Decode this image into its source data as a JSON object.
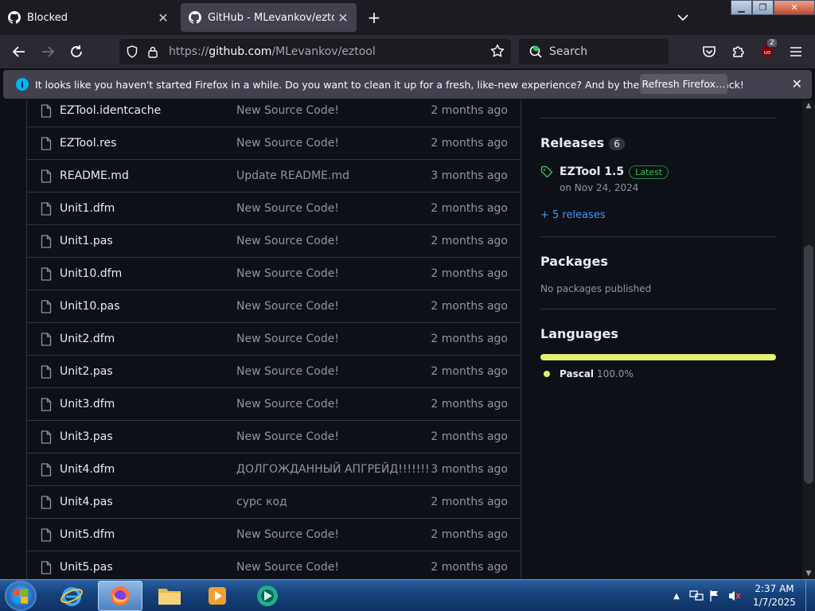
{
  "tabs": [
    {
      "title": "Blocked",
      "active": false
    },
    {
      "title": "GitHub - MLevankov/eztool: Пр",
      "active": true
    }
  ],
  "url": {
    "prefix": "https://",
    "host": "github.com",
    "path": "/MLevankov/eztool"
  },
  "search": {
    "placeholder": "Search"
  },
  "extension_badge": "2",
  "notification": {
    "message": "It looks like you haven't started Firefox in a while. Do you want to clean it up for a fresh, like-new experience? And by the way, welcome back!",
    "button": "Refresh Firefox…"
  },
  "files": [
    {
      "name": "EZTool.identcache",
      "commit": "New Source Code!",
      "age": "2 months ago"
    },
    {
      "name": "EZTool.res",
      "commit": "New Source Code!",
      "age": "2 months ago"
    },
    {
      "name": "README.md",
      "commit": "Update README.md",
      "age": "3 months ago"
    },
    {
      "name": "Unit1.dfm",
      "commit": "New Source Code!",
      "age": "2 months ago"
    },
    {
      "name": "Unit1.pas",
      "commit": "New Source Code!",
      "age": "2 months ago"
    },
    {
      "name": "Unit10.dfm",
      "commit": "New Source Code!",
      "age": "2 months ago"
    },
    {
      "name": "Unit10.pas",
      "commit": "New Source Code!",
      "age": "2 months ago"
    },
    {
      "name": "Unit2.dfm",
      "commit": "New Source Code!",
      "age": "2 months ago"
    },
    {
      "name": "Unit2.pas",
      "commit": "New Source Code!",
      "age": "2 months ago"
    },
    {
      "name": "Unit3.dfm",
      "commit": "New Source Code!",
      "age": "2 months ago"
    },
    {
      "name": "Unit3.pas",
      "commit": "New Source Code!",
      "age": "2 months ago"
    },
    {
      "name": "Unit4.dfm",
      "commit": "ДОЛГОЖДАННЫЙ АПГРЕЙД!!!!!!!",
      "age": "3 months ago"
    },
    {
      "name": "Unit4.pas",
      "commit": "сурс код",
      "age": "2 months ago"
    },
    {
      "name": "Unit5.dfm",
      "commit": "New Source Code!",
      "age": "2 months ago"
    },
    {
      "name": "Unit5.pas",
      "commit": "New Source Code!",
      "age": "2 months ago"
    }
  ],
  "sidebar": {
    "releases": {
      "title": "Releases",
      "count": "6",
      "latest_name": "EZTool 1.5",
      "latest_badge": "Latest",
      "latest_date": "on Nov 24, 2024",
      "more": "+ 5 releases"
    },
    "packages": {
      "title": "Packages",
      "empty": "No packages published"
    },
    "languages": {
      "title": "Languages",
      "items": [
        {
          "name": "Pascal",
          "percent": "100.0%",
          "share": 100,
          "color": "#e3f171"
        }
      ]
    }
  },
  "taskbar": {
    "time": "2:37 AM",
    "date": "1/7/2025"
  },
  "colors": {
    "accent_link": "#4493f8",
    "latest_green": "#3fb950",
    "page_bg": "#0d1117"
  }
}
